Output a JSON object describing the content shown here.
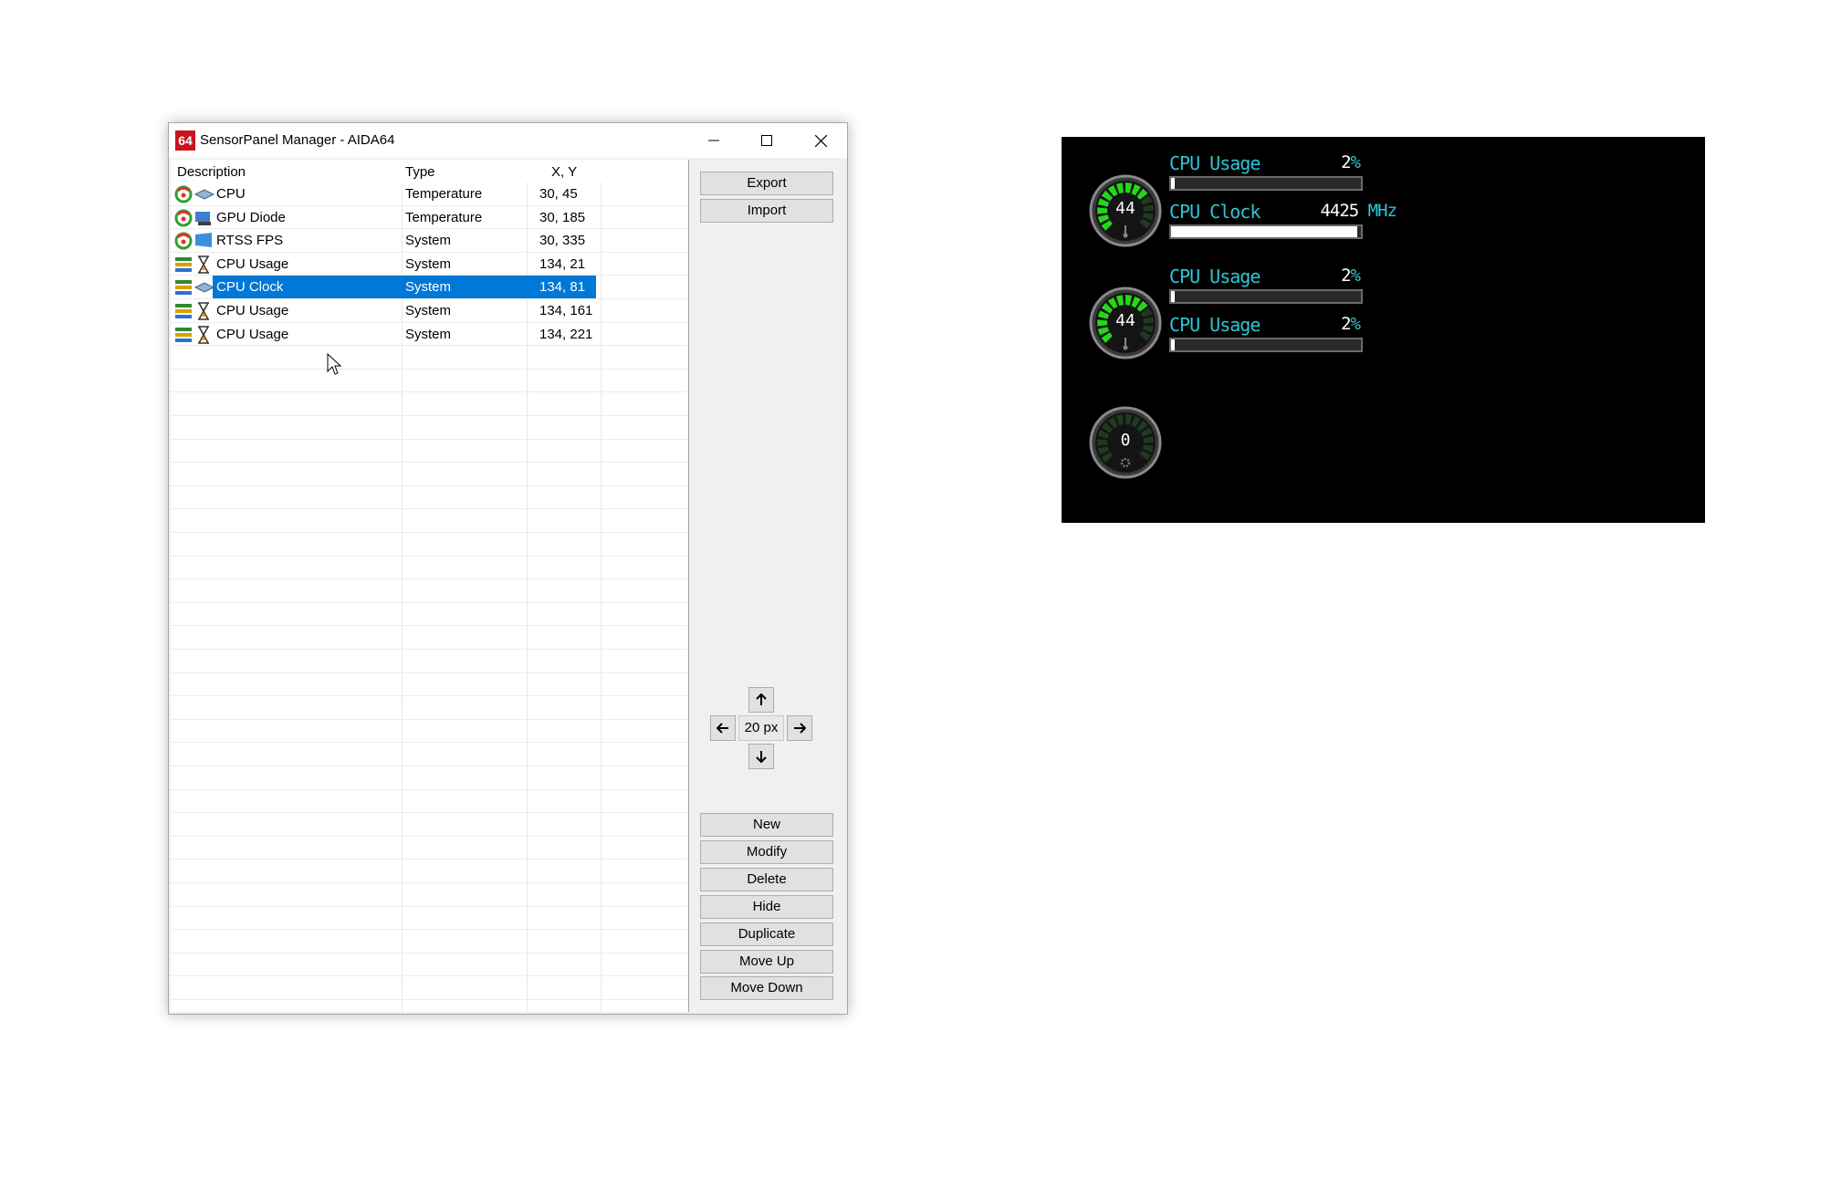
{
  "window": {
    "app_icon_text": "64",
    "title": "SensorPanel Manager - AIDA64"
  },
  "list": {
    "columns": [
      "Description",
      "Type",
      "X, Y"
    ],
    "rows": [
      {
        "description": "CPU",
        "type": "Temperature",
        "xy": "30, 45",
        "kind": "temperature",
        "device": "cpu-chip"
      },
      {
        "description": "GPU Diode",
        "type": "Temperature",
        "xy": "30, 185",
        "kind": "temperature",
        "device": "gpu"
      },
      {
        "description": "RTSS FPS",
        "type": "System",
        "xy": "30, 335",
        "kind": "temperature",
        "device": "rtss"
      },
      {
        "description": "CPU Usage",
        "type": "System",
        "xy": "134, 21",
        "kind": "bar",
        "device": "hourglass"
      },
      {
        "description": "CPU Clock",
        "type": "System",
        "xy": "134, 81",
        "kind": "bar",
        "device": "cpu-chip",
        "selected": true
      },
      {
        "description": "CPU Usage",
        "type": "System",
        "xy": "134, 161",
        "kind": "bar",
        "device": "hourglass"
      },
      {
        "description": "CPU Usage",
        "type": "System",
        "xy": "134, 221",
        "kind": "bar",
        "device": "hourglass"
      }
    ]
  },
  "buttons": {
    "export": "Export",
    "import": "Import",
    "step": "20 px",
    "new": "New",
    "modify": "Modify",
    "delete": "Delete",
    "hide": "Hide",
    "duplicate": "Duplicate",
    "move_up": "Move Up",
    "move_down": "Move Down"
  },
  "panel": {
    "gauges": [
      {
        "value": "44",
        "level": 0.75,
        "icon": "thermometer-icon"
      },
      {
        "value": "44",
        "level": 0.75,
        "icon": "thermometer-icon"
      },
      {
        "value": "0",
        "level": 0.0,
        "icon": "gear-icon"
      }
    ],
    "items": [
      {
        "label": "CPU Usage",
        "value": "2",
        "unit": "%",
        "fill": 0.02
      },
      {
        "label": "CPU Clock",
        "value": "4425",
        "unit": "MHz",
        "fill": 0.98
      },
      {
        "label": "CPU Usage",
        "value": "2",
        "unit": "%",
        "fill": 0.02
      },
      {
        "label": "CPU Usage",
        "value": "2",
        "unit": "%",
        "fill": 0.02
      }
    ]
  },
  "colors": {
    "selection": "#0078d7",
    "panel_label": "#2ec6d6",
    "gauge_green": "#22d81a",
    "app_icon": "#c8141e"
  }
}
